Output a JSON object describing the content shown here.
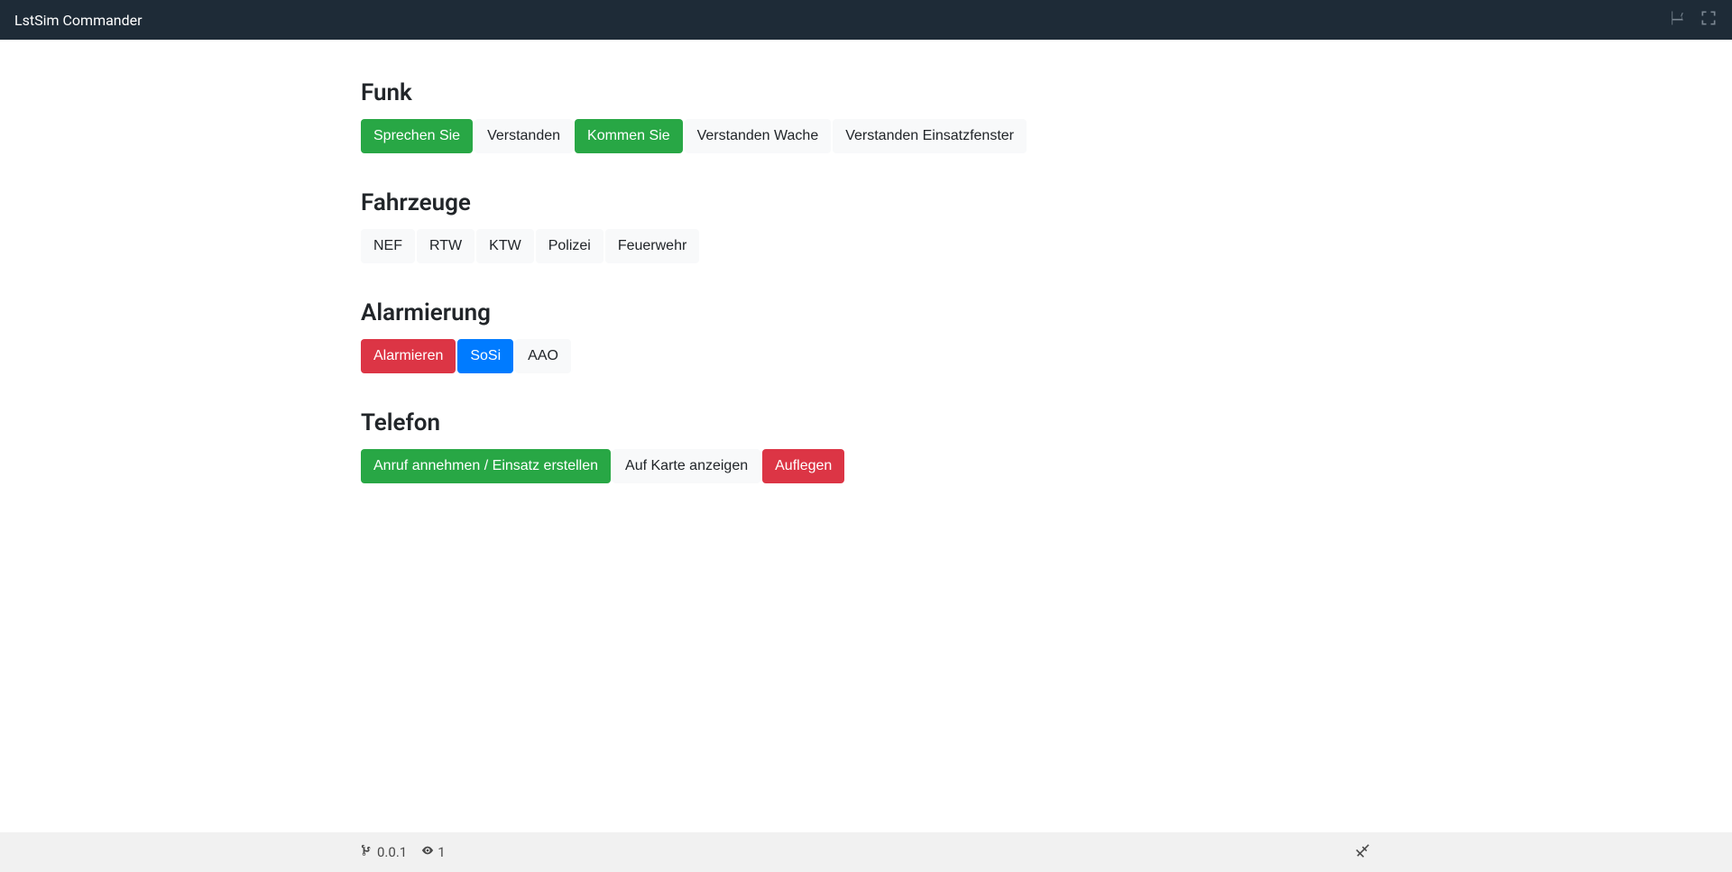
{
  "navbar": {
    "title": "LstSim Commander"
  },
  "sections": {
    "funk": {
      "title": "Funk",
      "buttons": [
        {
          "label": "Sprechen Sie",
          "style": "green"
        },
        {
          "label": "Verstanden",
          "style": "light"
        },
        {
          "label": "Kommen Sie",
          "style": "green"
        },
        {
          "label": "Verstanden Wache",
          "style": "light"
        },
        {
          "label": "Verstanden Einsatzfenster",
          "style": "light"
        }
      ]
    },
    "fahrzeuge": {
      "title": "Fahrzeuge",
      "buttons": [
        {
          "label": "NEF",
          "style": "light"
        },
        {
          "label": "RTW",
          "style": "light"
        },
        {
          "label": "KTW",
          "style": "light"
        },
        {
          "label": "Polizei",
          "style": "light"
        },
        {
          "label": "Feuerwehr",
          "style": "light"
        }
      ]
    },
    "alarmierung": {
      "title": "Alarmierung",
      "buttons": [
        {
          "label": "Alarmieren",
          "style": "red"
        },
        {
          "label": "SoSi",
          "style": "blue"
        },
        {
          "label": "AAO",
          "style": "light"
        }
      ]
    },
    "telefon": {
      "title": "Telefon",
      "buttons": [
        {
          "label": "Anruf annehmen / Einsatz erstellen",
          "style": "green"
        },
        {
          "label": "Auf Karte anzeigen",
          "style": "light"
        },
        {
          "label": "Auflegen",
          "style": "red"
        }
      ]
    }
  },
  "footer": {
    "version": "0.0.1",
    "viewers": "1"
  }
}
